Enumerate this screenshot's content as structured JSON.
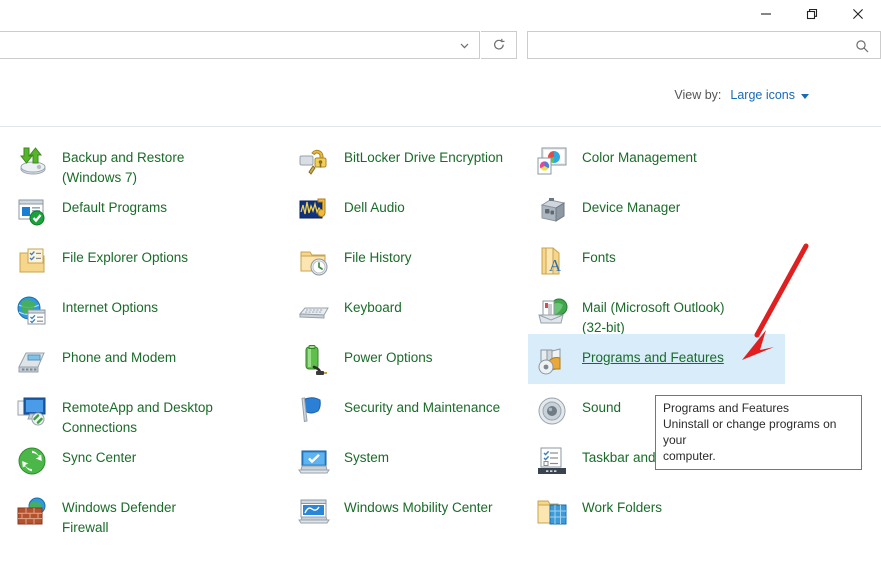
{
  "window": {
    "controls": [
      {
        "name": "minimize",
        "label": "Minimize"
      },
      {
        "name": "restore",
        "label": "Restore"
      },
      {
        "name": "close",
        "label": "Close"
      }
    ]
  },
  "toolbar": {
    "address_value": "",
    "address_placeholder": "",
    "address_chevron": "chevron-down-icon",
    "refresh_icon": "refresh-icon",
    "search_value": "",
    "search_placeholder": "",
    "search_icon": "search-icon"
  },
  "viewby": {
    "label": "View by:",
    "value": "Large icons",
    "caret": "caret-down-icon"
  },
  "columns": [
    {
      "name": "column-1",
      "items": [
        {
          "label": "Backup and Restore\n(Windows 7)",
          "icon": "backup-restore-icon"
        },
        {
          "label": "Default Programs",
          "icon": "default-programs-icon"
        },
        {
          "label": "File Explorer Options",
          "icon": "file-explorer-options-icon"
        },
        {
          "label": "Internet Options",
          "icon": "internet-options-icon"
        },
        {
          "label": "Phone and Modem",
          "icon": "phone-modem-icon"
        },
        {
          "label": "RemoteApp and Desktop\nConnections",
          "icon": "remoteapp-icon"
        },
        {
          "label": "Sync Center",
          "icon": "sync-center-icon"
        },
        {
          "label": "Windows Defender\nFirewall",
          "icon": "windows-defender-firewall-icon"
        }
      ]
    },
    {
      "name": "column-2",
      "items": [
        {
          "label": "BitLocker Drive Encryption",
          "icon": "bitlocker-icon"
        },
        {
          "label": "Dell Audio",
          "icon": "dell-audio-icon"
        },
        {
          "label": "File History",
          "icon": "file-history-icon"
        },
        {
          "label": "Keyboard",
          "icon": "keyboard-icon"
        },
        {
          "label": "Power Options",
          "icon": "power-options-icon"
        },
        {
          "label": "Security and Maintenance",
          "icon": "security-maintenance-icon"
        },
        {
          "label": "System",
          "icon": "system-icon"
        },
        {
          "label": "Windows Mobility Center",
          "icon": "windows-mobility-center-icon"
        }
      ]
    },
    {
      "name": "column-3",
      "items": [
        {
          "label": "Color Management",
          "icon": "color-management-icon",
          "selected": false
        },
        {
          "label": "Device Manager",
          "icon": "device-manager-icon",
          "selected": false
        },
        {
          "label": "Fonts",
          "icon": "fonts-icon",
          "selected": false
        },
        {
          "label": "Mail (Microsoft Outlook)\n(32-bit)",
          "icon": "mail-icon",
          "selected": false
        },
        {
          "label": "Programs and Features",
          "icon": "programs-features-icon",
          "selected": true
        },
        {
          "label": "Sound",
          "icon": "sound-icon",
          "selected": false
        },
        {
          "label": "Taskbar and Navigation",
          "icon": "taskbar-navigation-icon",
          "selected": false
        },
        {
          "label": "Work Folders",
          "icon": "work-folders-icon",
          "selected": false
        }
      ]
    }
  ],
  "tooltip": {
    "title": "Programs and Features",
    "description": "Uninstall or change programs on your\ncomputer."
  },
  "annotation": {
    "type": "arrow",
    "color": "#e02020",
    "points": "from upper-right to Programs and Features"
  },
  "colors": {
    "link_green": "#1a6b29",
    "selection_blue": "#d8ecf9",
    "viewby_blue": "#1a6ab5",
    "annotation_red": "#e02020",
    "border_gray": "#cccccc"
  }
}
